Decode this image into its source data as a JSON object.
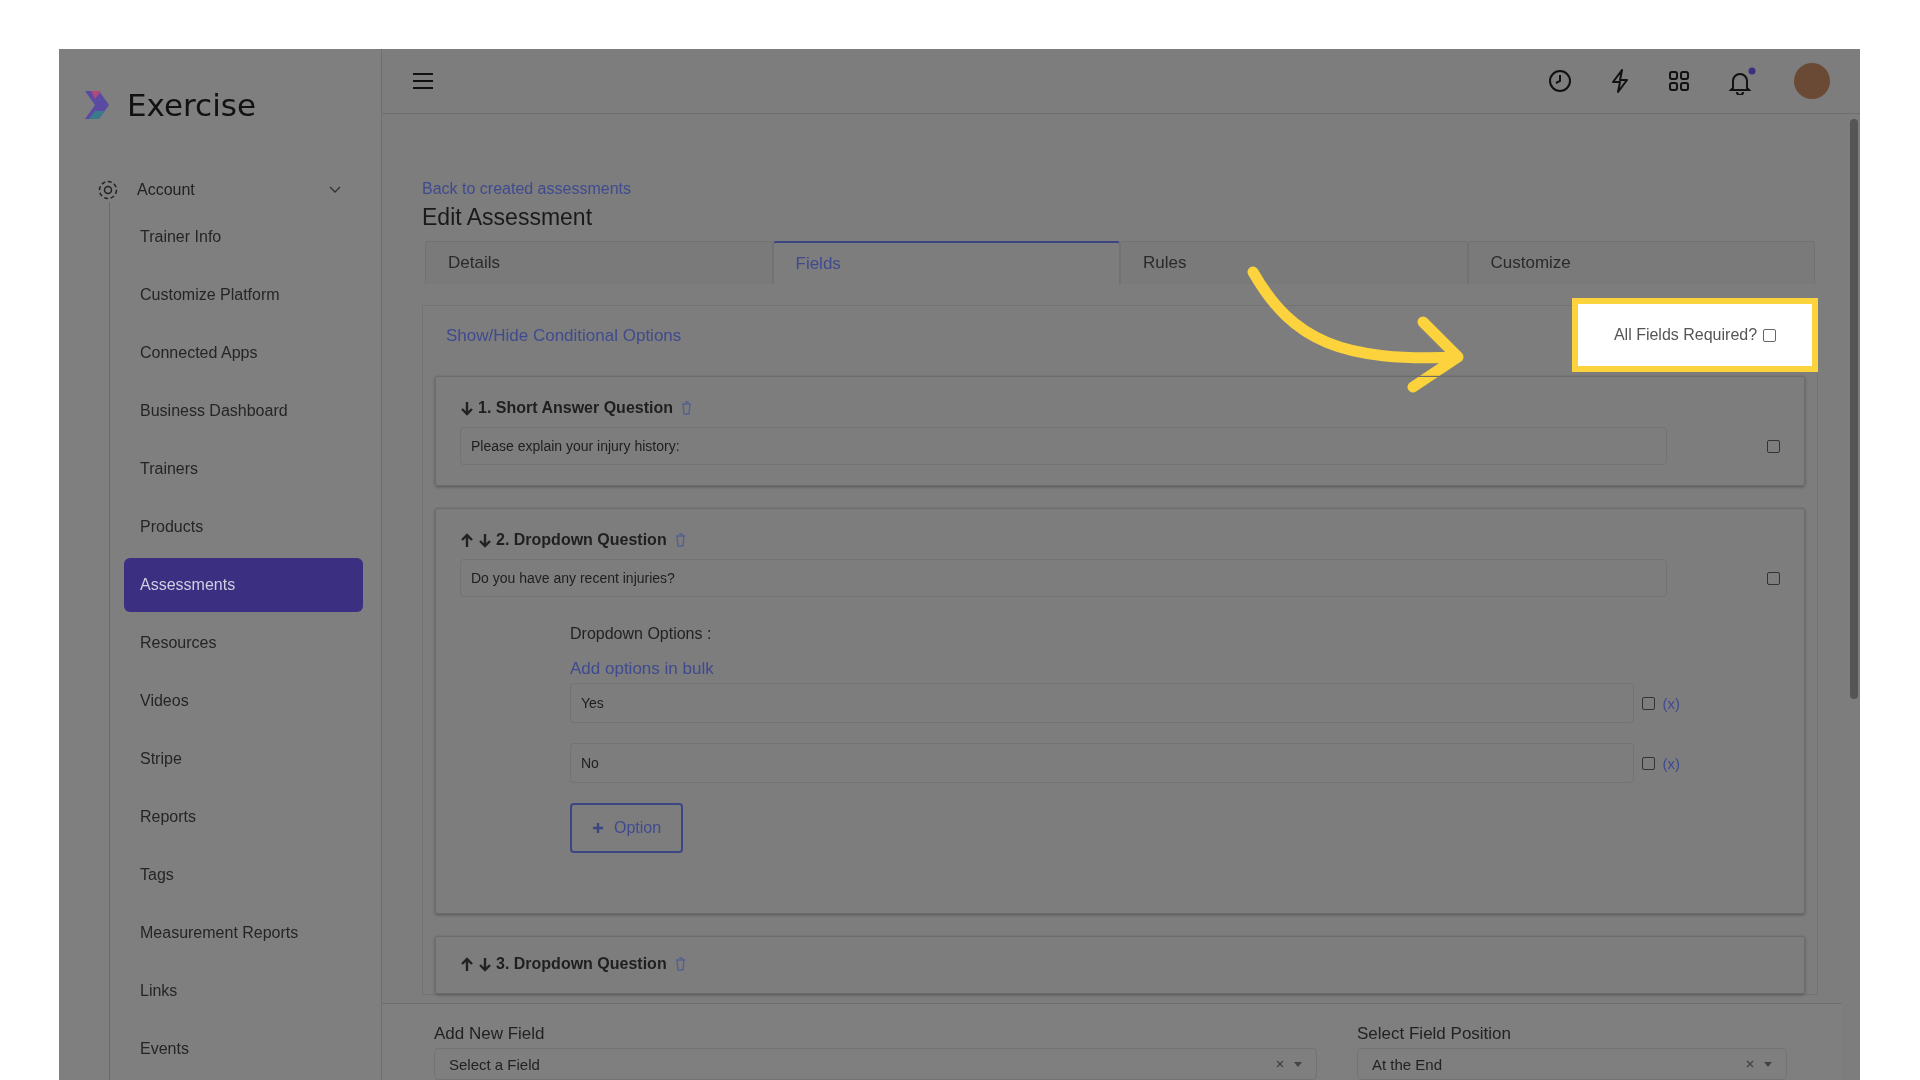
{
  "brand": {
    "name": "Exercise"
  },
  "sidebar": {
    "group": {
      "label": "Account",
      "expanded": true
    },
    "items": [
      {
        "label": "Trainer Info",
        "selected": false
      },
      {
        "label": "Customize Platform",
        "selected": false
      },
      {
        "label": "Connected Apps",
        "selected": false
      },
      {
        "label": "Business Dashboard",
        "selected": false
      },
      {
        "label": "Trainers",
        "selected": false
      },
      {
        "label": "Products",
        "selected": false
      },
      {
        "label": "Assessments",
        "selected": true
      },
      {
        "label": "Resources",
        "selected": false
      },
      {
        "label": "Videos",
        "selected": false
      },
      {
        "label": "Stripe",
        "selected": false
      },
      {
        "label": "Reports",
        "selected": false
      },
      {
        "label": "Tags",
        "selected": false
      },
      {
        "label": "Measurement Reports",
        "selected": false
      },
      {
        "label": "Links",
        "selected": false
      },
      {
        "label": "Events",
        "selected": false
      }
    ]
  },
  "back_link": "Back to created assessments",
  "title": "Edit Assessment",
  "tabs": [
    {
      "label": "Details",
      "selected": false
    },
    {
      "label": "Fields",
      "selected": true
    },
    {
      "label": "Rules",
      "selected": false
    },
    {
      "label": "Customize",
      "selected": false
    }
  ],
  "conditional_link": "Show/Hide Conditional Options",
  "all_required": {
    "label": "All Fields Required?",
    "checked": false
  },
  "questions": [
    {
      "title": "1. Short Answer Question",
      "up": false,
      "down": true,
      "value": "Please explain your injury history:",
      "checked": false
    },
    {
      "title": "2. Dropdown Question",
      "up": true,
      "down": true,
      "value": "Do you have any recent injuries?",
      "checked": false,
      "options_label": "Dropdown Options :",
      "bulk_link": "Add options in bulk",
      "options": [
        {
          "value": "Yes",
          "checked": false,
          "remove": "(x)"
        },
        {
          "value": "No",
          "checked": false,
          "remove": "(x)"
        }
      ],
      "add_button": "Option"
    },
    {
      "title": "3. Dropdown Question",
      "up": true,
      "down": true
    }
  ],
  "footer": {
    "add_label": "Add New Field",
    "add_value": "Select a Field",
    "position_label": "Select Field Position",
    "position_value": "At the End"
  }
}
